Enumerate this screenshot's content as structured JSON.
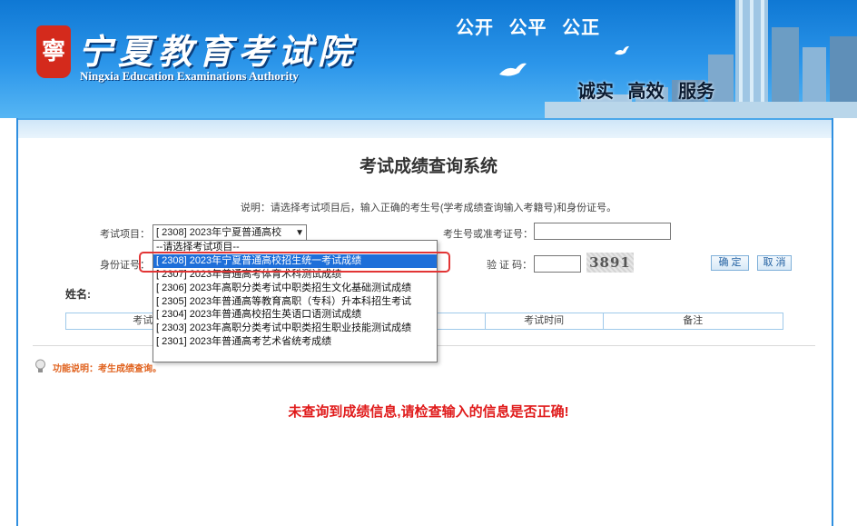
{
  "header": {
    "logo_title": "宁夏教育考试院",
    "logo_subtitle": "Ningxia Education Examinations Authority",
    "slogan_top": "公开 公平 公正",
    "slogan_bottom": "诚实 高效 服务"
  },
  "main": {
    "title": "考试成绩查询系统",
    "instruction": "说明：请选择考试项目后，输入正确的考生号(学考成绩查询输入考籍号)和身份证号。",
    "exam_label": "考试项目：",
    "exam_selected": "[ 2308] 2023年宁夏普通高校",
    "candidate_label": "考生号或准考证号：",
    "candidate_value": "",
    "id_label": "身份证号：",
    "captcha_label": "验 证 码：",
    "captcha_value": "",
    "captcha_text": "3891",
    "confirm_label": "确 定",
    "cancel_label": "取 消",
    "name_label": "姓名:",
    "table_headers": [
      "考试",
      "",
      "",
      "考试时间",
      "备注"
    ],
    "func_note": "功能说明：考生成绩查询。",
    "error_message": "未查询到成绩信息,请检查输入的信息是否正确!"
  },
  "dropdown": {
    "options": [
      "--请选择考试项目--",
      "[ 2308] 2023年宁夏普通高校招生统一考试成绩",
      "[ 2307] 2023年普通高考体育术科测试成绩",
      "[ 2306] 2023年高职分类考试中职类招生文化基础测试成绩",
      "[ 2305] 2023年普通高等教育高职（专科）升本科招生考试",
      "[ 2304] 2023年普通高校招生英语口语测试成绩",
      "[ 2303] 2023年高职分类考试中职类招生职业技能测试成绩",
      "[ 2301] 2023年普通高考艺术省统考成绩"
    ],
    "selected_index": 1
  },
  "colors": {
    "header_blue": "#1e82dc",
    "selection_blue": "#1e6fd9",
    "error_red": "#e01b1b",
    "note_orange": "#e0621e",
    "highlight_red": "#e23535"
  }
}
